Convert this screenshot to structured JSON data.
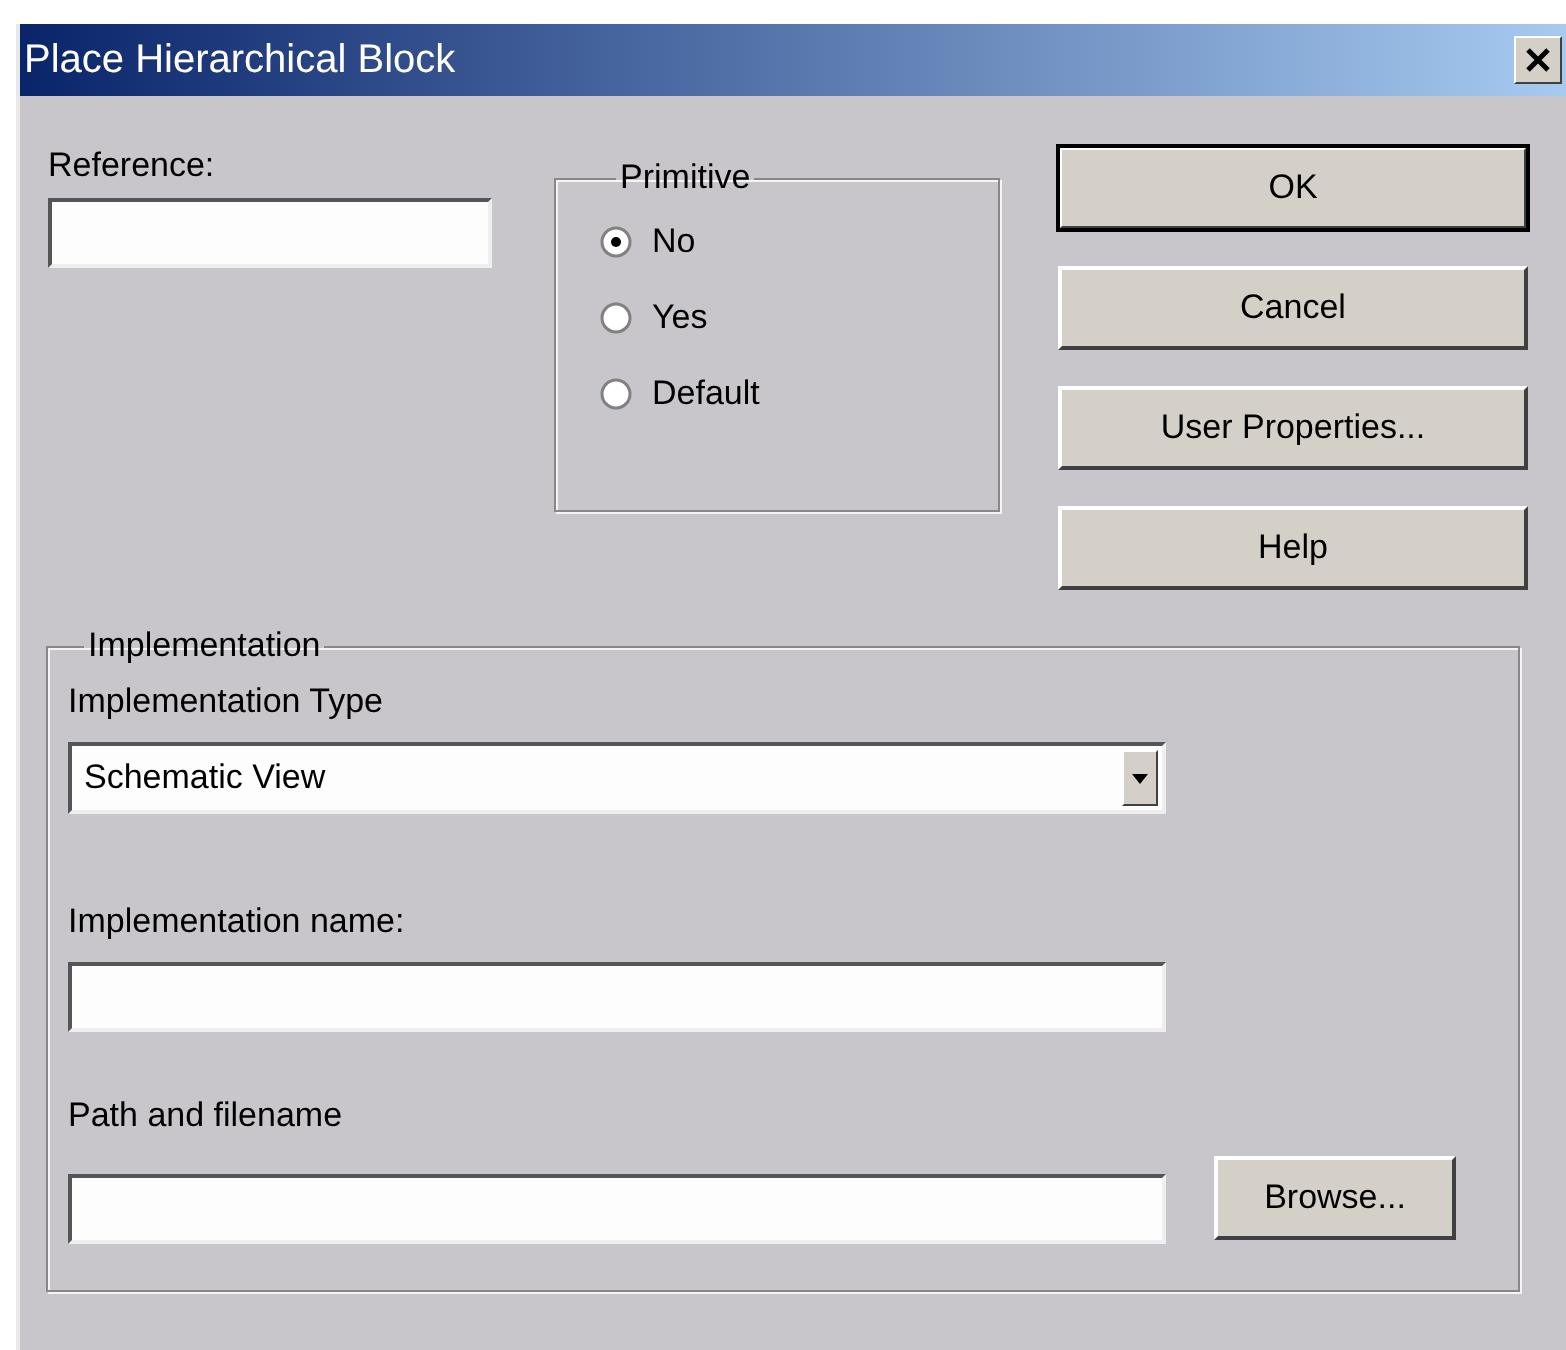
{
  "window": {
    "title": "Place Hierarchical Block"
  },
  "reference": {
    "label": "Reference:"
  },
  "primitive": {
    "title": "Primitive",
    "options": [
      {
        "label": "No",
        "selected": true
      },
      {
        "label": "Yes",
        "selected": false
      },
      {
        "label": "Default",
        "selected": false
      }
    ]
  },
  "buttons": [
    {
      "label": "OK",
      "default": true
    },
    {
      "label": "Cancel",
      "default": false
    },
    {
      "label": "User Properties...",
      "default": false
    },
    {
      "label": "Help",
      "default": false
    }
  ],
  "implementation": {
    "title": "Implementation",
    "type_label": "Implementation Type",
    "type_value": "Schematic View",
    "name_label": "Implementation name:",
    "path_label": "Path and filename",
    "browse_button": "Browse..."
  }
}
